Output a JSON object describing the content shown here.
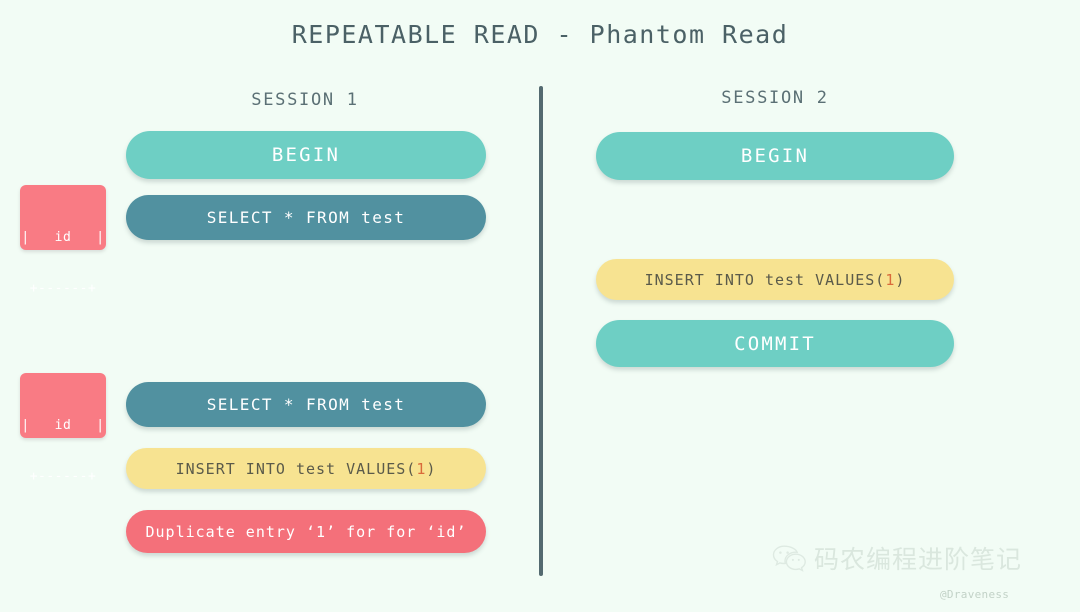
{
  "title": "REPEATABLE READ - Phantom Read",
  "colors": {
    "background": "#f2fcf5",
    "pill_green": "#6ecfc4",
    "pill_dark_teal": "#5191a0",
    "pill_yellow": "#f7e391",
    "pill_red": "#f4707a",
    "result_box_red": "#f97b84",
    "divider": "#546a70",
    "title_text": "#4b6166",
    "accent_number": "#d96a3a"
  },
  "sessions": {
    "session_1": {
      "header": "SESSION 1",
      "steps": [
        {
          "label": "BEGIN",
          "style": "green"
        },
        {
          "label": "SELECT * FROM test",
          "style": "dark-teal"
        },
        {
          "label": "SELECT * FROM test",
          "style": "dark-teal"
        },
        {
          "label_prefix": "INSERT INTO test VALUES(",
          "label_value": "1",
          "label_suffix": ")",
          "style": "yellow"
        },
        {
          "label": "Duplicate entry ‘1’ for for ‘id’",
          "style": "red"
        }
      ],
      "results": [
        {
          "line1": "|   id   |",
          "line2": "+------+"
        },
        {
          "line1": "|   id   |",
          "line2": "+------+"
        }
      ]
    },
    "session_2": {
      "header": "SESSION 2",
      "steps": [
        {
          "label": "BEGIN",
          "style": "green"
        },
        {
          "label_prefix": "INSERT INTO test VALUES(",
          "label_value": "1",
          "label_suffix": ")",
          "style": "yellow"
        },
        {
          "label": "COMMIT",
          "style": "green"
        }
      ]
    }
  },
  "watermark": {
    "icon": "wechat-icon",
    "text": "码农编程进阶笔记",
    "credit": "@Draveness"
  }
}
